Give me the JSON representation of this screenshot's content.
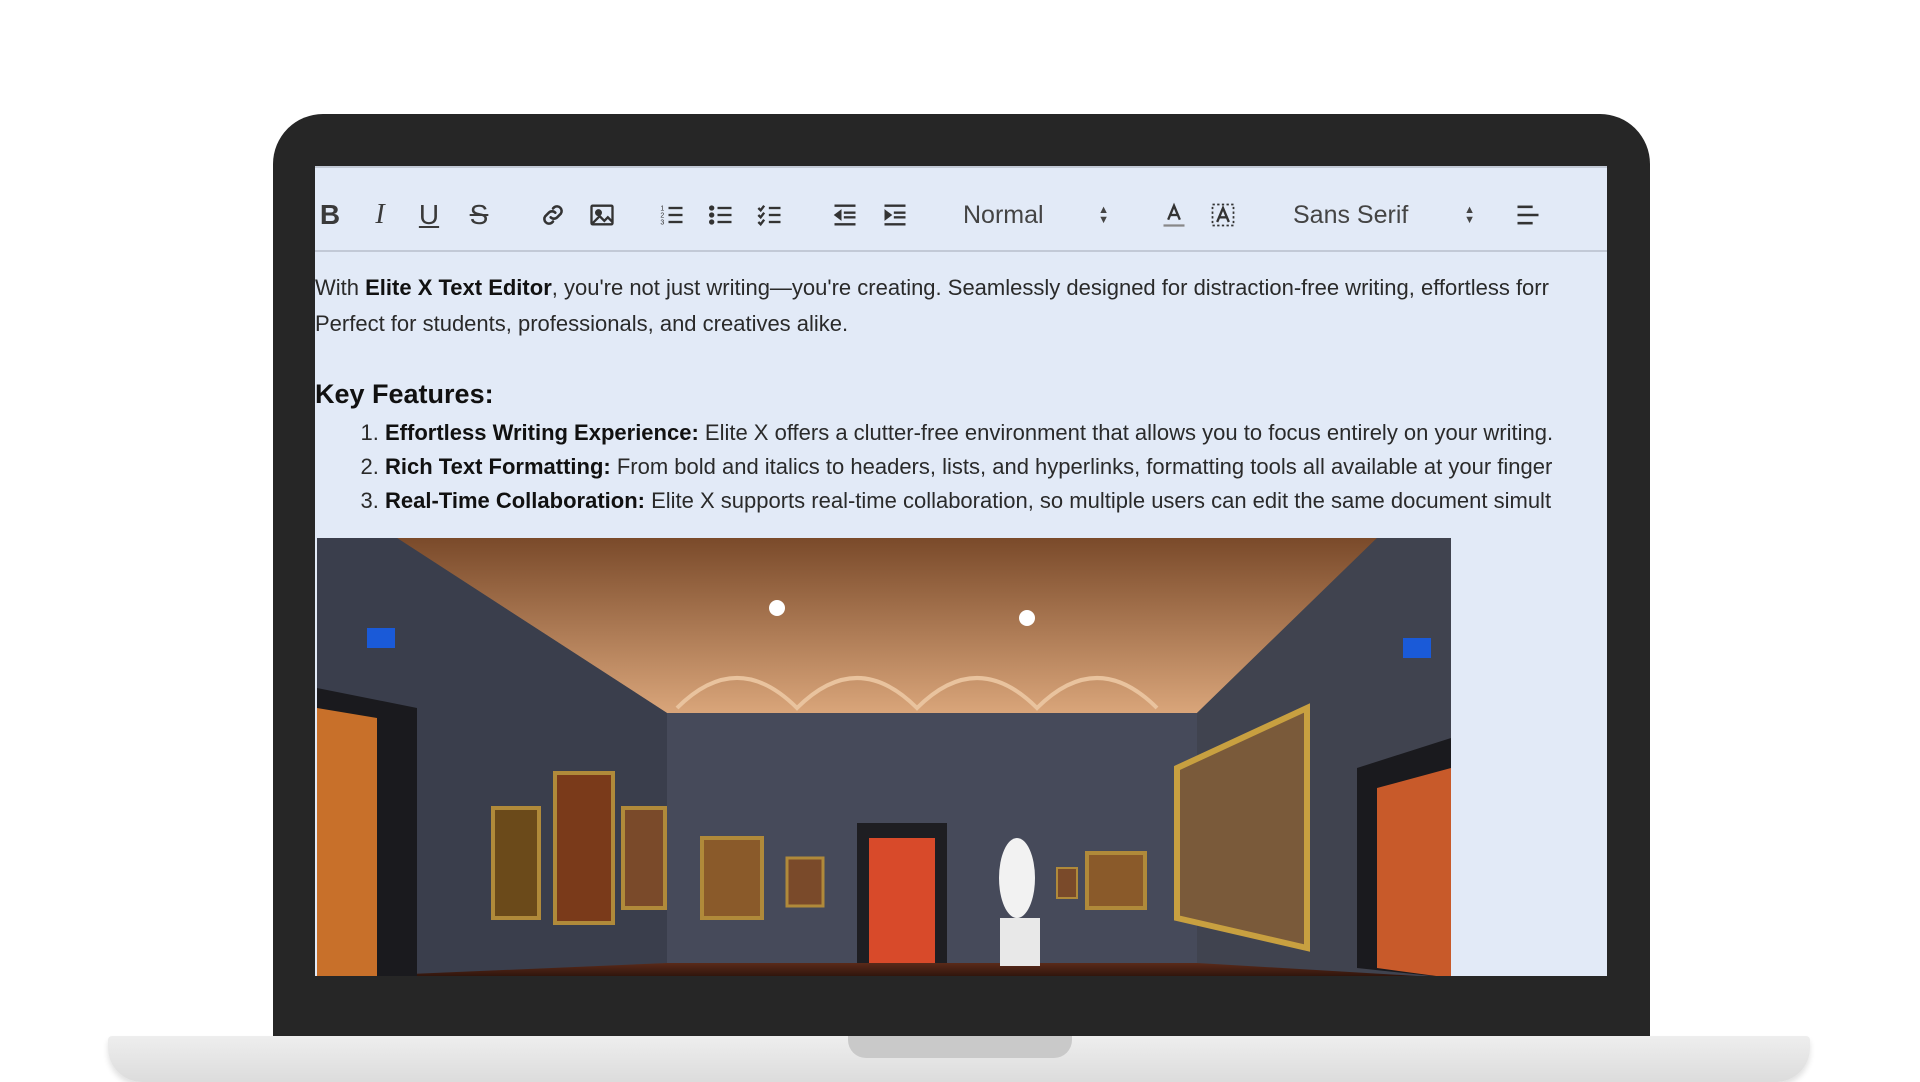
{
  "toolbar": {
    "bold": "B",
    "italic": "I",
    "underline": "U",
    "strike": "S",
    "block_format": "Normal",
    "font_family": "Sans Serif"
  },
  "content": {
    "intro_prefix": "With ",
    "intro_bold": "Elite X Text Editor",
    "intro_rest": ", you're not just writing—you're creating. Seamlessly designed for distraction-free writing, effortless forr",
    "intro_line2": "Perfect for students, professionals, and creatives alike.",
    "heading": "Key Features:",
    "features": [
      {
        "title": "Effortless Writing Experience:",
        "text": " Elite X offers a clutter-free environment that allows you to focus entirely on your writing."
      },
      {
        "title": "Rich Text Formatting:",
        "text": " From bold and italics to headers, lists, and hyperlinks, formatting tools all available at your finger"
      },
      {
        "title": "Real-Time Collaboration:",
        "text": " Elite X supports real-time collaboration, so multiple users can edit the same document simult"
      }
    ]
  },
  "colors": {
    "editor_bg": "#e2eaf7",
    "frame": "#262626",
    "toolbar_border": "#c2c9d6"
  }
}
